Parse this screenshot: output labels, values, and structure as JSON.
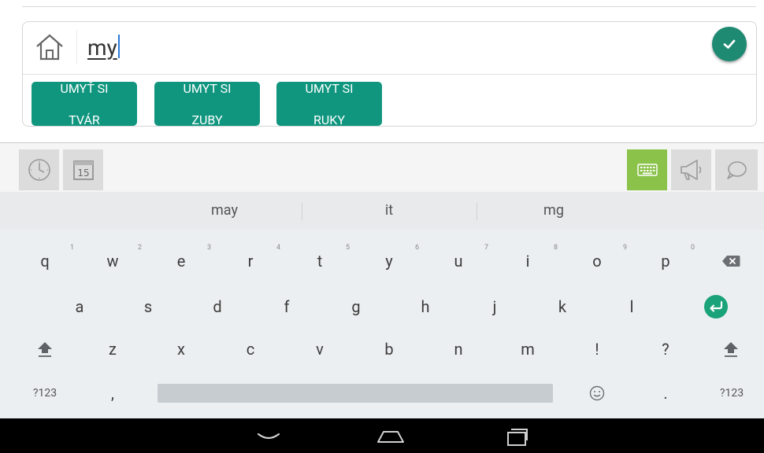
{
  "input": {
    "value": "my"
  },
  "suggestions": [
    {
      "line1": "UMYŤ SI",
      "line2": "TVÁR"
    },
    {
      "line1": "UMYT SI",
      "line2": "ZUBY"
    },
    {
      "line1": "UMYT SI",
      "line2": "RUKY"
    }
  ],
  "word_suggestions": [
    "may",
    "it",
    "mg"
  ],
  "toolbar": {
    "calendar_day": "15"
  },
  "keyboard": {
    "row1": [
      {
        "key": "q",
        "num": "1"
      },
      {
        "key": "w",
        "num": "2"
      },
      {
        "key": "e",
        "num": "3"
      },
      {
        "key": "r",
        "num": "4"
      },
      {
        "key": "t",
        "num": "5"
      },
      {
        "key": "y",
        "num": "6"
      },
      {
        "key": "u",
        "num": "7"
      },
      {
        "key": "i",
        "num": "8"
      },
      {
        "key": "o",
        "num": "9"
      },
      {
        "key": "p",
        "num": "0"
      }
    ],
    "row2": [
      "a",
      "s",
      "d",
      "f",
      "g",
      "h",
      "j",
      "k",
      "l"
    ],
    "row3": [
      "z",
      "x",
      "c",
      "v",
      "b",
      "n",
      "m",
      "!",
      "?"
    ],
    "symbols_left": "?123",
    "comma": ",",
    "period": ".",
    "symbols_right": "?123"
  },
  "colors": {
    "accent": "#10967f",
    "confirm": "#1e8a72",
    "keyboard_mode_active": "#8bc34a"
  }
}
